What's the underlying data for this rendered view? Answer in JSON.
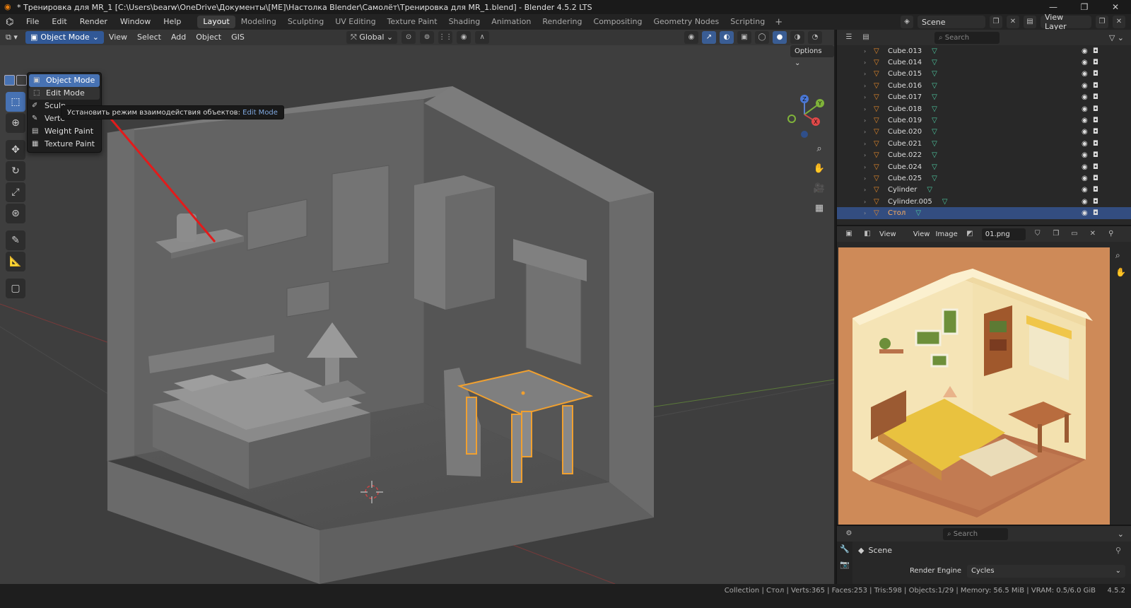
{
  "window": {
    "title": "* Тренировка для MR_1 [C:\\Users\\bearw\\OneDrive\\Документы\\[ME]\\Настолка Blender\\Самолёт\\Тренировка для MR_1.blend] - Blender 4.5.2 LTS",
    "minimize": "—",
    "maximize": "❐",
    "close": "✕"
  },
  "menubar": {
    "menus": [
      "File",
      "Edit",
      "Render",
      "Window",
      "Help"
    ],
    "workspaces": [
      "Layout",
      "Modeling",
      "Sculpting",
      "UV Editing",
      "Texture Paint",
      "Shading",
      "Animation",
      "Rendering",
      "Compositing",
      "Geometry Nodes",
      "Scripting"
    ],
    "active_workspace": "Layout",
    "scene": "Scene",
    "view_layer": "View Layer"
  },
  "viewport": {
    "mode": "Object Mode",
    "menus": [
      "View",
      "Select",
      "Add",
      "Object",
      "GIS"
    ],
    "orientation": "Global",
    "options": "Options",
    "gizmo": {
      "z": "Z",
      "y": "Y",
      "x": "X"
    }
  },
  "mode_menu": {
    "items": [
      {
        "label": "Object Mode",
        "icon": "object-icon",
        "state": "selected"
      },
      {
        "label": "Edit Mode",
        "icon": "edit-icon",
        "state": "hover"
      },
      {
        "label": "Sculpt Mode",
        "icon": "sculpt-icon",
        "state": ""
      },
      {
        "label": "Vertex Paint",
        "icon": "vertex-paint-icon",
        "state": ""
      },
      {
        "label": "Weight Paint",
        "icon": "weight-paint-icon",
        "state": ""
      },
      {
        "label": "Texture Paint",
        "icon": "texture-paint-icon",
        "state": ""
      }
    ],
    "visible_labels": [
      "Object Mode",
      "Edit Mode",
      "Sculp",
      "Verte",
      "Weight Paint",
      "Texture Paint"
    ]
  },
  "tooltip": {
    "text": "Установить режим взаимодействия объектов:",
    "value": "Edit Mode"
  },
  "outliner": {
    "search_placeholder": "Search",
    "rows": [
      {
        "name": "Cube.013",
        "selected": false
      },
      {
        "name": "Cube.014",
        "selected": false
      },
      {
        "name": "Cube.015",
        "selected": false
      },
      {
        "name": "Cube.016",
        "selected": false
      },
      {
        "name": "Cube.017",
        "selected": false
      },
      {
        "name": "Cube.018",
        "selected": false
      },
      {
        "name": "Cube.019",
        "selected": false
      },
      {
        "name": "Cube.020",
        "selected": false
      },
      {
        "name": "Cube.021",
        "selected": false
      },
      {
        "name": "Cube.022",
        "selected": false
      },
      {
        "name": "Cube.024",
        "selected": false
      },
      {
        "name": "Cube.025",
        "selected": false
      },
      {
        "name": "Cylinder",
        "selected": false
      },
      {
        "name": "Cylinder.005",
        "selected": false
      },
      {
        "name": "Стол",
        "selected": true
      }
    ]
  },
  "image_editor": {
    "view_label": "View",
    "menus": [
      "View",
      "Image"
    ],
    "filename": "01.png"
  },
  "properties": {
    "search_placeholder": "Search",
    "scene_label": "Scene",
    "render_engine_label": "Render Engine",
    "render_engine_value": "Cycles"
  },
  "statusbar": {
    "text": "Collection | Стол | Verts:365 | Faces:253 | Tris:598 | Objects:1/29 | Memory: 56.5 MiB | VRAM: 0.5/6.0 GiB",
    "version": "4.5.2"
  },
  "colors": {
    "accent": "#4772b3",
    "selection_outline": "#f0a030",
    "arrow": "#e21b1b"
  }
}
